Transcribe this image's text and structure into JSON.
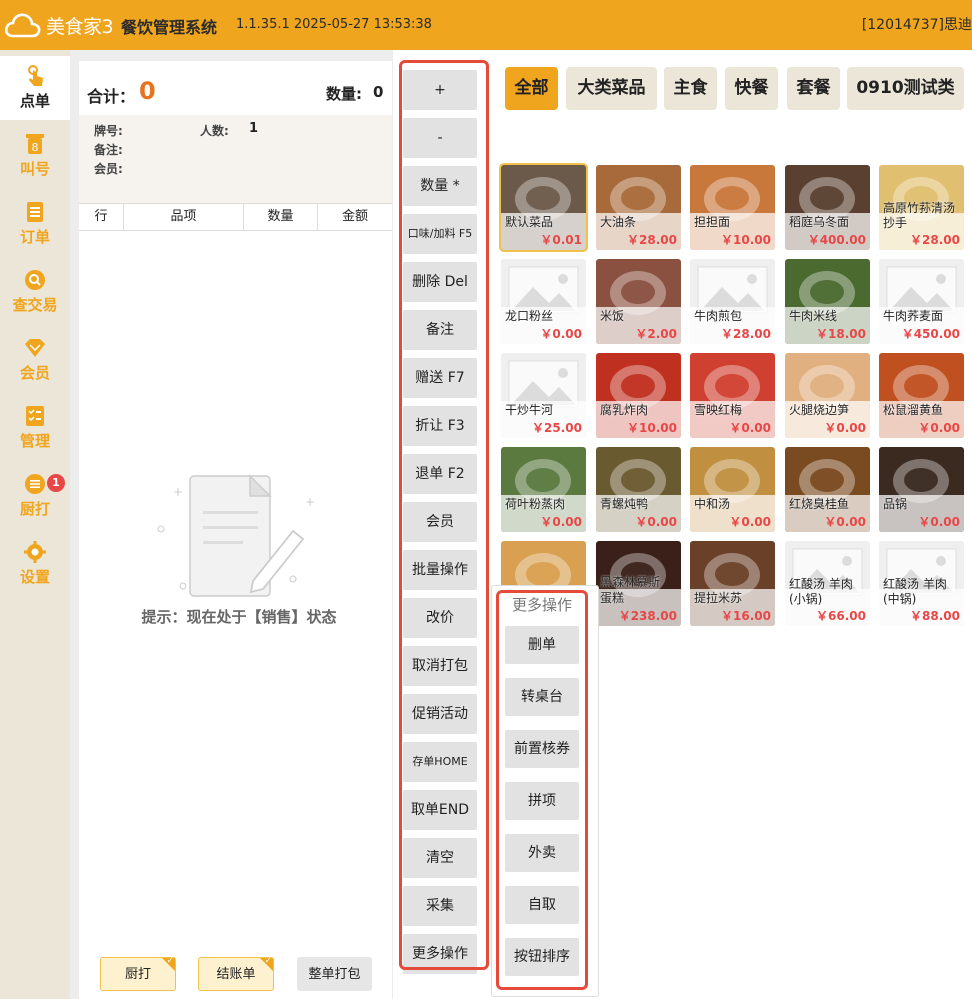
{
  "header": {
    "logo_text": "美食家3",
    "app_title": "餐饮管理系统",
    "version": "1.1.35.1 2025-05-27 13:53:38",
    "store_id": "[12014737]思迪"
  },
  "nav": {
    "items": [
      {
        "label": "点单",
        "icon": "hand-tap-icon"
      },
      {
        "label": "叫号",
        "icon": "call-number-icon",
        "icon_text": "8"
      },
      {
        "label": "订单",
        "icon": "order-list-icon"
      },
      {
        "label": "查交易",
        "icon": "search-icon"
      },
      {
        "label": "会员",
        "icon": "diamond-icon"
      },
      {
        "label": "管理",
        "icon": "manage-icon"
      },
      {
        "label": "厨打",
        "icon": "kitchen-print-icon",
        "badge": "1"
      },
      {
        "label": "设置",
        "icon": "gear-icon"
      }
    ]
  },
  "order": {
    "sum_label": "合计：",
    "sum_value": "0",
    "qty_label": "数量:",
    "qty_value": "0",
    "plate_label": "牌号:",
    "people_label": "人数:",
    "people_value": "1",
    "note_label": "备注:",
    "member_label": "会员:",
    "columns": [
      "行",
      "品项",
      "数量",
      "金额"
    ],
    "hint": "提示：现在处于【销售】状态",
    "buttons": {
      "kitchen": "厨打",
      "checkout": "结账单",
      "pack_all": "整单打包"
    }
  },
  "actions": [
    "+",
    "-",
    "数量 *",
    "口味/加料 F5",
    "删除 Del",
    "备注",
    "赠送 F7",
    "折让 F3",
    "退单 F2",
    "会员",
    "批量操作",
    "改价",
    "取消打包",
    "促销活动",
    "存单HOME",
    "取单END",
    "清空",
    "采集",
    "更多操作"
  ],
  "categories": [
    "全部",
    "大类菜品",
    "主食",
    "快餐",
    "套餐",
    "0910测试类"
  ],
  "dishes": [
    {
      "name": "默认菜品",
      "price": "￥0.01",
      "color": "#6b5a4a"
    },
    {
      "name": "大油条",
      "price": "￥28.00",
      "color": "#a86a3a"
    },
    {
      "name": "担担面",
      "price": "￥10.00",
      "color": "#c9783c"
    },
    {
      "name": "稻庭乌冬面",
      "price": "￥400.00",
      "color": "#5a4030"
    },
    {
      "name": "高原竹荪清汤抄手",
      "price": "￥28.00",
      "color": "#e0c070"
    },
    {
      "name": "龙口粉丝",
      "price": "￥0.00",
      "color": ""
    },
    {
      "name": "米饭",
      "price": "￥2.00",
      "color": "#8a5040"
    },
    {
      "name": "牛肉煎包",
      "price": "￥28.00",
      "color": ""
    },
    {
      "name": "牛肉米线",
      "price": "￥18.00",
      "color": "#4a6a30"
    },
    {
      "name": "牛肉荞麦面",
      "price": "￥450.00",
      "color": ""
    },
    {
      "name": "干炒牛河",
      "price": "￥25.00",
      "color": ""
    },
    {
      "name": "腐乳炸肉",
      "price": "￥10.00",
      "color": "#c03020"
    },
    {
      "name": "雪映红梅",
      "price": "￥0.00",
      "color": "#d04030"
    },
    {
      "name": "火腿烧边笋",
      "price": "￥0.00",
      "color": "#e0b080"
    },
    {
      "name": "松鼠溜黄鱼",
      "price": "￥0.00",
      "color": "#c05020"
    },
    {
      "name": "荷叶粉蒸肉",
      "price": "￥0.00",
      "color": "#5a7a40"
    },
    {
      "name": "青螺炖鸭",
      "price": "￥0.00",
      "color": "#6a5a30"
    },
    {
      "name": "中和汤",
      "price": "￥0.00",
      "color": "#c09040"
    },
    {
      "name": "红烧臭桂鱼",
      "price": "￥0.00",
      "color": "#7a4a20"
    },
    {
      "name": "品锅",
      "price": "￥0.00",
      "color": "#3a2a20"
    },
    {
      "name": "",
      "price": "",
      "color": "#d8a050"
    },
    {
      "name": "蛋糕",
      "name_prefix": "黑森林慕斯",
      "price": "￥238.00",
      "color": "#3a2018"
    },
    {
      "name": "提拉米苏",
      "price": "￥16.00",
      "color": "#6a4028"
    },
    {
      "name": "红酸汤 羊肉(小锅)",
      "price": "￥66.00",
      "color": ""
    },
    {
      "name": "红酸汤 羊肉(中锅)",
      "price": "￥88.00",
      "color": ""
    }
  ],
  "more_ops": {
    "title": "更多操作",
    "items": [
      "删单",
      "转桌台",
      "前置核券",
      "拼项",
      "外卖",
      "自取",
      "按钮排序"
    ]
  },
  "colors": {
    "brand": "#f0a51e",
    "highlight": "#e64a3b",
    "price": "#e84747"
  }
}
